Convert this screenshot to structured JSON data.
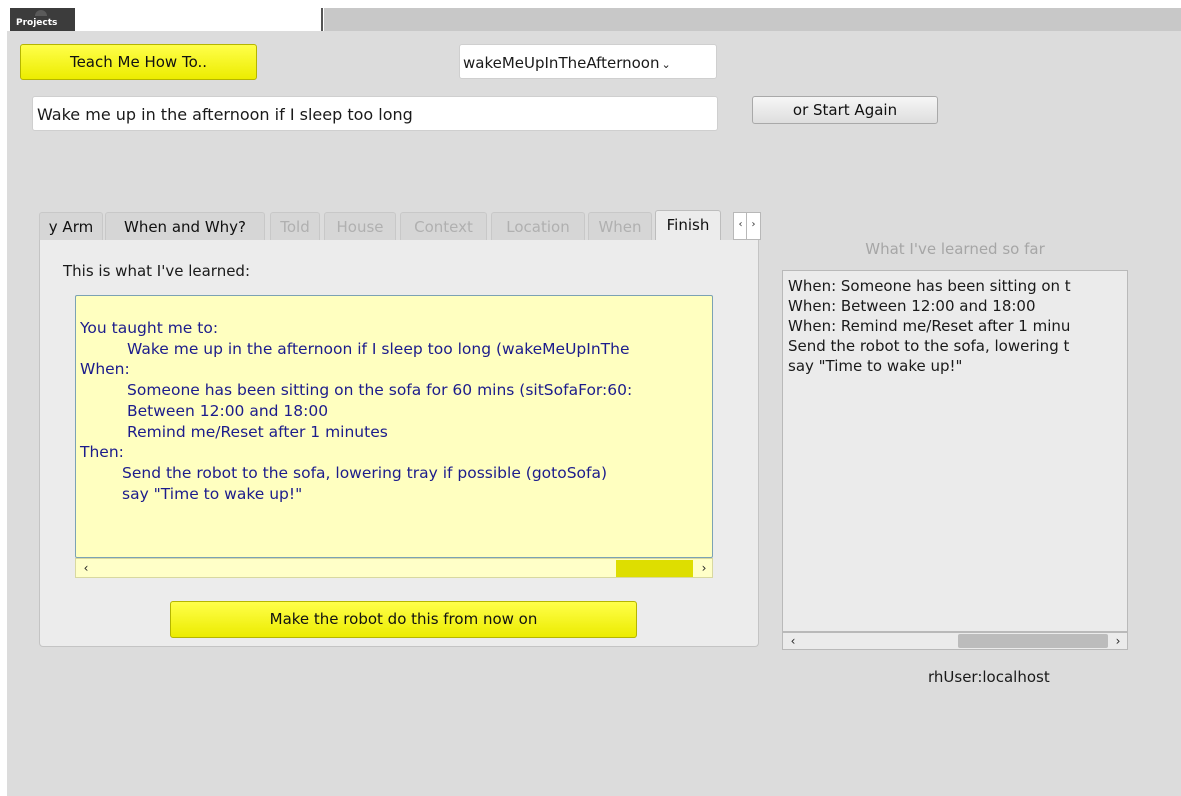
{
  "topbar": {
    "projects_tab": "Projects"
  },
  "controls": {
    "teach_button": "Teach Me How To..",
    "behaviour_select": "wakeMeUpInTheAfternoon",
    "description_value": "Wake me up in the afternoon if I sleep too long",
    "restart_button": "or Start Again"
  },
  "tabs": [
    {
      "label": "y Arm",
      "state": "enabled"
    },
    {
      "label": "When and Why?",
      "state": "enabled"
    },
    {
      "label": "Told",
      "state": "disabled"
    },
    {
      "label": "House",
      "state": "disabled"
    },
    {
      "label": "Context",
      "state": "disabled"
    },
    {
      "label": "Location",
      "state": "disabled"
    },
    {
      "label": "When",
      "state": "disabled"
    },
    {
      "label": "Finish",
      "state": "selected"
    }
  ],
  "tab_arrows": {
    "left": "‹",
    "right": "›"
  },
  "finish_panel": {
    "heading": "This is what I've learned:",
    "summary": {
      "taught_label": "You taught me to:",
      "taught_value": "Wake me up in the afternoon if I sleep too long (wakeMeUpInThe",
      "when_label": "When:",
      "when_items": [
        "Someone has been sitting on the sofa for 60 mins (sitSofaFor:60:",
        "Between 12:00 and 18:00",
        "Remind me/Reset after 1 minutes"
      ],
      "then_label": "Then:",
      "then_items": [
        "Send the robot to the sofa, lowering tray if possible (gotoSofa)",
        "say \"Time to wake up!\""
      ]
    },
    "make_button": "Make the robot do this from now on"
  },
  "learned_panel": {
    "title": "What I've learned so far",
    "lines": [
      "When: Someone has been sitting on t",
      "When: Between 12:00 and 18:00",
      "When: Remind me/Reset after 1 minu",
      "Send the robot to the sofa, lowering t",
      "say \"Time to wake up!\""
    ]
  },
  "status": {
    "user": "rhUser:localhost"
  },
  "colors": {
    "button_yellow": "#f2f200",
    "summary_background": "#ffffc0",
    "summary_text": "#1c1c8c",
    "panel_gray": "#dcdcdc"
  }
}
